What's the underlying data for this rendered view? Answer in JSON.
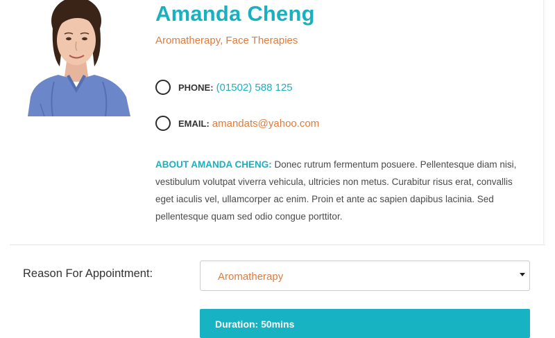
{
  "profile": {
    "name": "Amanda Cheng",
    "specialties": "Aromatherapy, Face Therapies",
    "phone_label": "PHONE:",
    "phone_value": "(01502) 588 125",
    "email_label": "EMAIL:",
    "email_value": "amandats@yahoo.com",
    "about_heading": "ABOUT AMANDA CHENG:",
    "about_text": "Donec rutrum fermentum posuere. Pellentesque diam nisi, vestibulum volutpat viverra vehicula, ultricies non metus. Curabitur risus erat, convallis eget iaculis vel, ullamcorper ac enim. Proin et ante ac sapien dapibus lacinia. Sed pellentesque quam sed odio congue porttitor."
  },
  "booking": {
    "reason_label": "Reason For Appointment:",
    "reason_selected": "Aromatherapy",
    "duration_text": "Duration: 50mins"
  },
  "icons": {
    "phone": "circle-icon",
    "email": "circle-icon",
    "dropdown": "caret-down-icon"
  },
  "colors": {
    "accent_teal": "#1ab0c0",
    "accent_orange": "#e07b3c",
    "duration_bar": "#18b3c3"
  }
}
